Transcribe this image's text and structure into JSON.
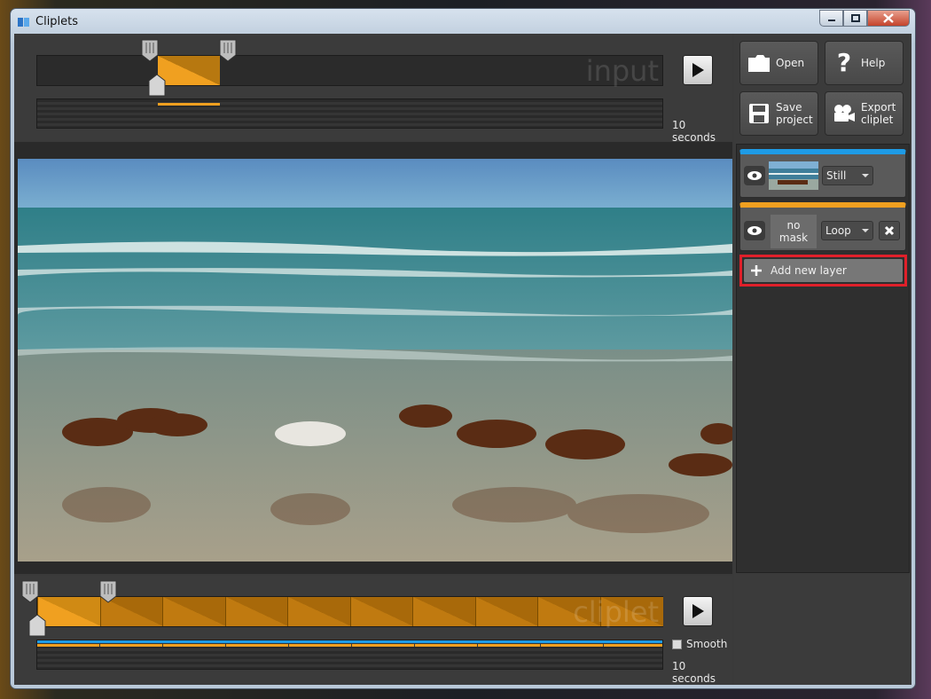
{
  "window": {
    "title": "Cliplets"
  },
  "input_timeline": {
    "label": "input",
    "duration": "10 seconds"
  },
  "cliplet_timeline": {
    "label": "cliplet",
    "duration": "10 seconds",
    "smooth_label": "Smooth",
    "smooth_checked": false,
    "segments": 10
  },
  "toolbar": {
    "open": "Open",
    "help": "Help",
    "save_line1": "Save",
    "save_line2": "project",
    "export_line1": "Export",
    "export_line2": "cliplet"
  },
  "layers": [
    {
      "mode": "Still",
      "accent": "#1e9be6"
    },
    {
      "mask_line1": "no",
      "mask_line2": "mask",
      "mode": "Loop",
      "accent": "#f0a020"
    }
  ],
  "add_layer": {
    "label": "Add new layer",
    "highlight": "#e0202a"
  },
  "colors": {
    "accent_orange": "#f0a020",
    "accent_blue": "#1e9be6"
  }
}
